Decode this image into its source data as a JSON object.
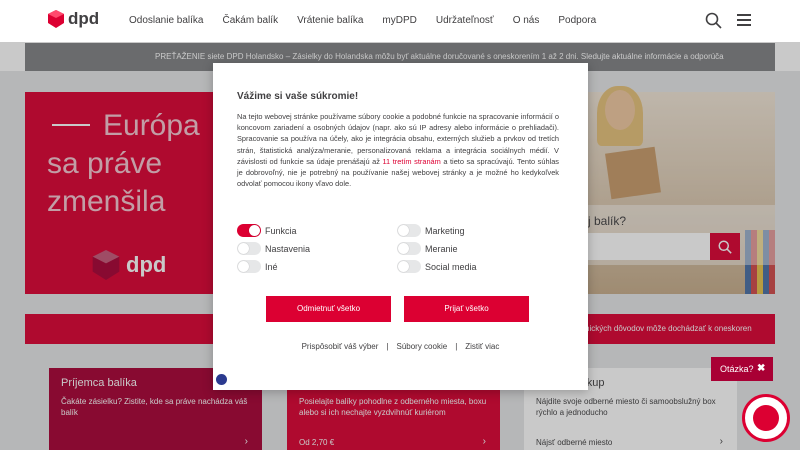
{
  "header": {
    "logo_text": "dpd",
    "nav": [
      "Odoslanie balíka",
      "Čakám balík",
      "Vrátenie balíka",
      "myDPD",
      "Udržateľnosť",
      "O nás",
      "Podpora"
    ]
  },
  "alert": {
    "text": "PREŤAŽENIE siete DPD Holandsko – Zásielky do Holandska môžu byť aktuálne doručované s oneskorením 1 až 2 dni. Sledujte aktuálne informácie a odporúča"
  },
  "hero": {
    "title_line1": "Európa",
    "title_line2": "sa práve",
    "title_line3": "zmenšila",
    "logo_text": "dpd",
    "search_question": "j balík?"
  },
  "red_bar": {
    "text": "nických dôvodov môže dochádzať k oneskoren"
  },
  "cards": [
    {
      "title": "Príjemca balíka",
      "desc": "Čakáte zásielku? Zistite, kde sa práve nachádza váš balík",
      "foot": ""
    },
    {
      "title": "",
      "desc": "Posielajte balíky pohodlne z odberného miesta, boxu alebo si ich nechajte vyzdvihnúť kuriérom",
      "foot": "Od 2,70 €"
    },
    {
      "title": "miesta Pickup",
      "desc": "Nájdite svoje odberné miesto či samoobslužný box rýchlo a jednoducho",
      "foot": "Nájsť odberné miesto"
    }
  ],
  "question_button": {
    "label": "Otázka?",
    "close": "✖"
  },
  "modal": {
    "title": "Vážime si vaše súkromie!",
    "body_before_link": "Na tejto webovej stránke používame súbory cookie a podobné funkcie na spracovanie informácií o koncovom zariadení a osobných údajov (napr. ako sú IP adresy alebo informácie o prehliadači). Spracovanie sa používa na účely, ako je integrácia obsahu, externých služieb a prvkov od tretích strán, štatistická analýza/meranie, personalizovaná reklama a integrácia sociálnych médií. V závislosti od funkcie sa údaje prenášajú až ",
    "body_link": "11 tretím stranám",
    "body_after_link": " a tieto sa spracúvajú. Tento súhlas je dobrovoľný, nie je potrebný na používanie našej webovej stránky a je možné ho kedykoľvek odvolať pomocou ikony vľavo dole.",
    "options_left": [
      {
        "label": "Funkcia",
        "on": true
      },
      {
        "label": "Nastavenia",
        "on": false
      },
      {
        "label": "Iné",
        "on": false
      }
    ],
    "options_right": [
      {
        "label": "Marketing",
        "on": false
      },
      {
        "label": "Meranie",
        "on": false
      },
      {
        "label": "Social media",
        "on": false
      }
    ],
    "reject_label": "Odmietnuť všetko",
    "accept_label": "Prijať všetko",
    "link_customize": "Prispôsobiť váš výber",
    "link_cookies": "Súbory cookie",
    "link_imprint": "Zistiť viac",
    "separator": "|"
  },
  "colors": {
    "brand_red": "#dc0032",
    "dark_red": "#a90034",
    "gray_bar": "#808285"
  }
}
